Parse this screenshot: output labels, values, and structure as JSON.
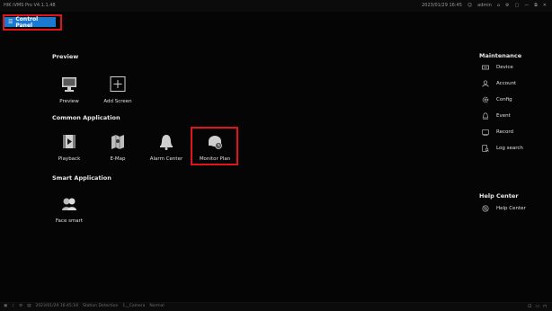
{
  "window": {
    "title": "HIK iVMS Pro V4.1.1.48",
    "datetime": "2023/01/29 16:45",
    "user": "admin",
    "controls": [
      "⌂",
      "⚙",
      "▢",
      "—",
      "⧉",
      "✕"
    ]
  },
  "tab": {
    "label": "Control Panel"
  },
  "preview": {
    "heading": "Preview",
    "items": [
      {
        "label": "Preview"
      },
      {
        "label": "Add Screen"
      }
    ]
  },
  "common": {
    "heading": "Common Application",
    "items": [
      {
        "label": "Playback"
      },
      {
        "label": "E-Map"
      },
      {
        "label": "Alarm Center"
      },
      {
        "label": "Monitor Plan"
      }
    ]
  },
  "smart": {
    "heading": "Smart Application",
    "items": [
      {
        "label": "Face smart"
      }
    ]
  },
  "maintenance": {
    "heading": "Maintenance",
    "items": [
      {
        "label": "Device"
      },
      {
        "label": "Account"
      },
      {
        "label": "Config"
      },
      {
        "label": "Event"
      },
      {
        "label": "Record"
      },
      {
        "label": "Log search"
      }
    ]
  },
  "help": {
    "heading": "Help Center",
    "items": [
      {
        "label": "Help Center"
      }
    ]
  },
  "status": {
    "datetime": "2023/01/29 16:45:18",
    "station": "Station Detection",
    "camera": "1__Camera",
    "state": "Normal"
  },
  "colors": {
    "accent": "#1a7ad1",
    "highlight": "#e0141b",
    "background": "#050505"
  }
}
